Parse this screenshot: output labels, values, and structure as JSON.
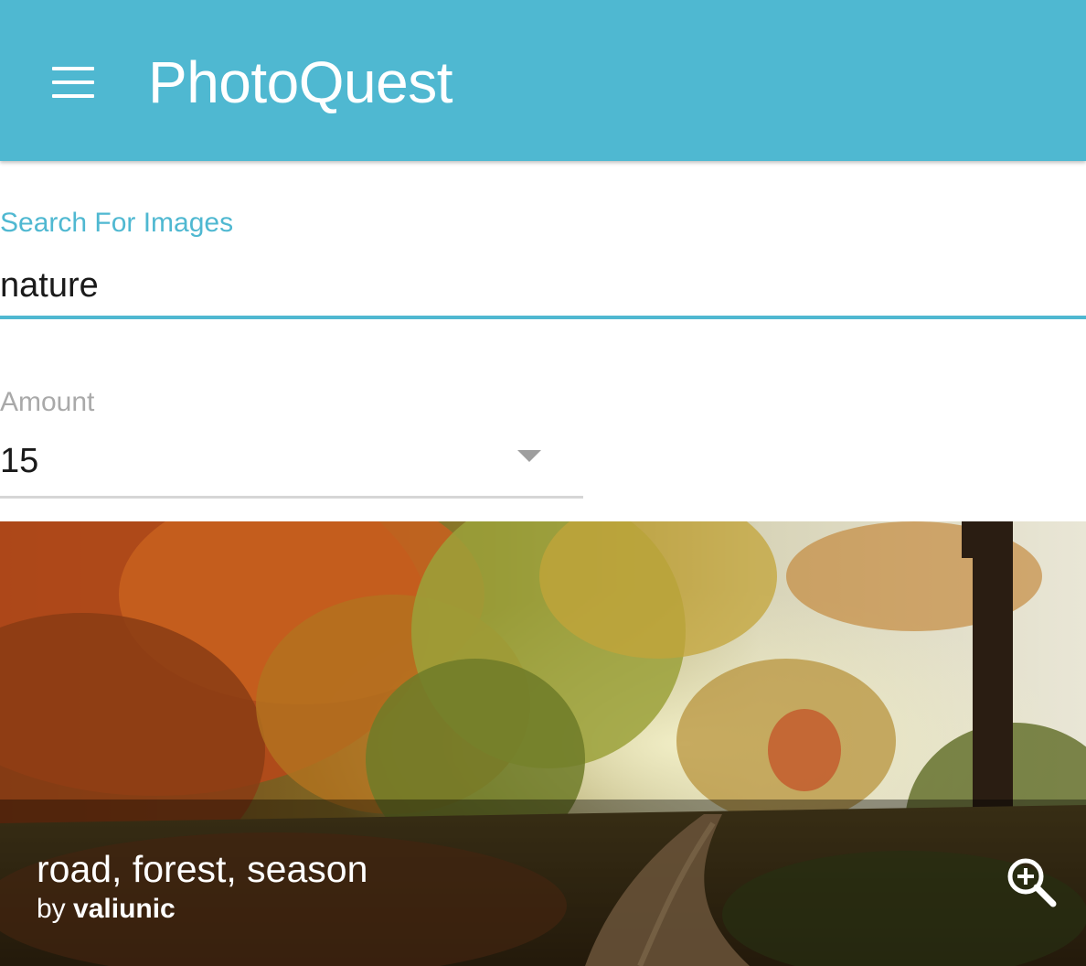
{
  "app_bar": {
    "menu_icon": "menu-icon",
    "title": "PhotoQuest",
    "background_color": "#4fb8d1"
  },
  "search": {
    "label": "Search For Images",
    "value": "nature",
    "accent_color": "#4fb8d1"
  },
  "amount": {
    "label": "Amount",
    "selected": "15",
    "dropdown_icon": "arrow-drop-down-icon"
  },
  "results": [
    {
      "tags": "road, forest, season",
      "by_prefix": "by",
      "author": "valiunic",
      "action_icon": "zoom-in-icon"
    }
  ]
}
